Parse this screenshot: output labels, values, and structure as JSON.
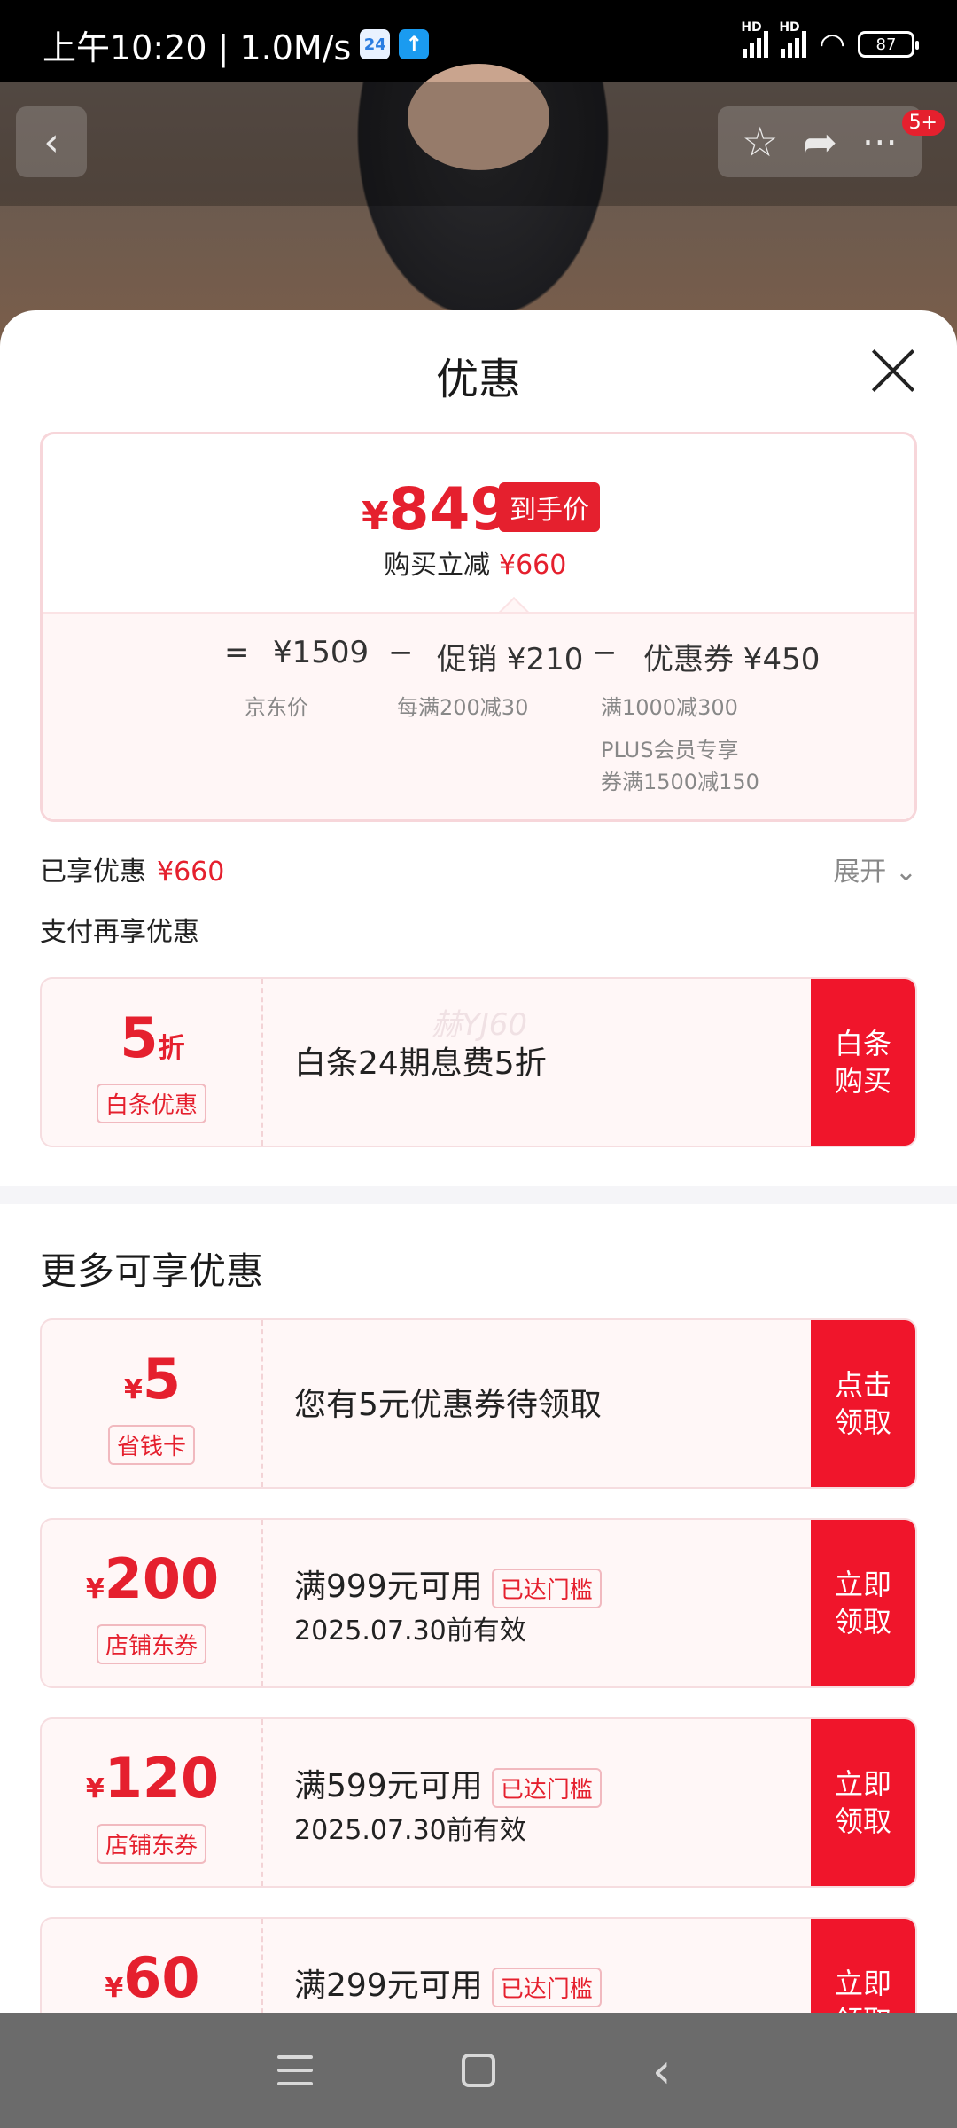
{
  "status": {
    "time": "上午10:20 | 1.0M/s",
    "badge_calendar": "24",
    "signal1": "HD",
    "signal2": "HD",
    "battery": "87"
  },
  "top_bar": {
    "more_badge": "5+"
  },
  "sheet": {
    "title": "优惠",
    "final_price": "849",
    "final_price_currency": "¥",
    "final_tag": "到手价",
    "buy_reduce_label": "购买立减",
    "buy_reduce_amount": "¥660",
    "formula": {
      "eq": "=",
      "jd_price": "¥1509",
      "minus1": "−",
      "promo": "促销 ¥210",
      "minus2": "−",
      "coupon": "优惠券 ¥450",
      "jd_price_label": "京东价",
      "promo_desc": "每满200减30",
      "coupon_desc1": "满1000减300",
      "coupon_desc2": "PLUS会员专享",
      "coupon_desc3": "券满1500减150"
    },
    "enjoyed_label": "已享优惠",
    "enjoyed_amount": "¥660",
    "expand_label": "展开",
    "pay_more_label": "支付再享优惠",
    "baitiao": {
      "value": "5",
      "unit": "折",
      "tag": "白条优惠",
      "desc": "白条24期息费5折",
      "watermark": "赫YJ60",
      "action": "白条购买"
    },
    "more_title": "更多可享优惠",
    "coupons": [
      {
        "currency": "¥",
        "value": "5",
        "tag": "省钱卡",
        "desc": "您有5元优惠券待领取",
        "action": "点击领取"
      },
      {
        "currency": "¥",
        "value": "200",
        "tag": "店铺东券",
        "line1": "满999元可用",
        "reached": "已达门槛",
        "line2": "2025.07.30前有效",
        "action": "立即领取"
      },
      {
        "currency": "¥",
        "value": "120",
        "tag": "店铺东券",
        "line1": "满599元可用",
        "reached": "已达门槛",
        "line2": "2025.07.30前有效",
        "action": "立即领取"
      },
      {
        "currency": "¥",
        "value": "60",
        "tag": "",
        "line1": "满299元可用",
        "reached": "已达门槛",
        "line2": "",
        "action": "立即领取"
      }
    ]
  },
  "colors": {
    "accent": "#e5202e",
    "action_bg": "#f0152b",
    "nav_bg": "#6b6b6b"
  }
}
